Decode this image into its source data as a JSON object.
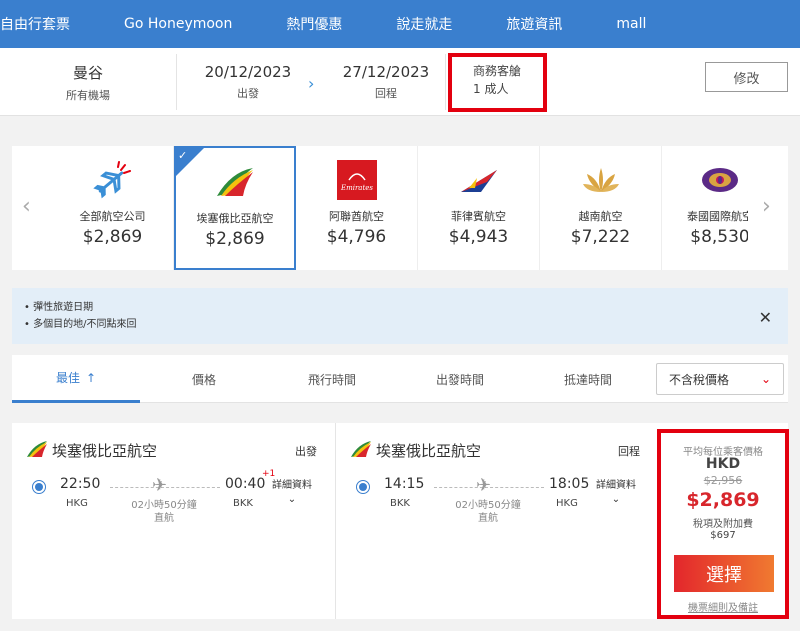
{
  "nav": {
    "items": [
      "自由行套票",
      "Go Honeymoon",
      "熱門優惠",
      "說走就走",
      "旅遊資訊",
      "mall"
    ]
  },
  "search": {
    "destination": "曼谷",
    "destination_sub": "所有機場",
    "depart_date": "20/12/2023",
    "depart_label": "出發",
    "return_date": "27/12/2023",
    "return_label": "回程",
    "cabin": "商務客艙",
    "passengers": "1 成人",
    "edit_label": "修改"
  },
  "airlines": [
    {
      "name": "全部航空公司",
      "price": "$2,869",
      "icon": "all-airlines-icon"
    },
    {
      "name": "埃塞俄比亞航空",
      "price": "$2,869",
      "icon": "ethiopian-logo",
      "selected": true
    },
    {
      "name": "阿聯酋航空",
      "price": "$4,796",
      "icon": "emirates-logo",
      "logo_text": "Emirates"
    },
    {
      "name": "菲律賓航空",
      "price": "$4,943",
      "icon": "philippine-airlines-logo"
    },
    {
      "name": "越南航空",
      "price": "$7,222",
      "icon": "vietnam-airlines-logo"
    },
    {
      "name": "泰國國際航空",
      "price": "$8,530",
      "icon": "thai-airways-logo"
    }
  ],
  "banner": {
    "line1": "• 彈性旅遊日期",
    "line2": "• 多個目的地/不同點來回"
  },
  "sort": {
    "tabs": [
      "最佳",
      "價格",
      "飛行時間",
      "出發時間",
      "抵達時間"
    ],
    "active_arrow": "↑",
    "tax_option": "不含稅價格"
  },
  "result": {
    "outbound": {
      "airline": "埃塞俄比亞航空",
      "direction": "出發",
      "dep_time": "22:50",
      "dep_airport": "HKG",
      "arr_time": "00:40",
      "arr_airport": "BKK",
      "day_offset": "+1",
      "duration": "02小時50分鐘",
      "stops": "直航",
      "details": "詳細資料"
    },
    "inbound": {
      "airline": "埃塞俄比亞航空",
      "direction": "回程",
      "dep_time": "14:15",
      "dep_airport": "BKK",
      "arr_time": "18:05",
      "arr_airport": "HKG",
      "duration": "02小時50分鐘",
      "stops": "直航",
      "details": "詳細資料"
    },
    "price": {
      "label": "平均每位乘客價格",
      "currency": "HKD",
      "original": "$2,956",
      "current": "$2,869",
      "tax_label": "稅項及附加費",
      "tax_value": "$697",
      "select_label": "選擇",
      "rules_link": "機票細則及備註"
    }
  },
  "colors": {
    "brand_blue": "#3a7fce",
    "highlight_red": "#e3000f",
    "price_red": "#d8262c"
  }
}
